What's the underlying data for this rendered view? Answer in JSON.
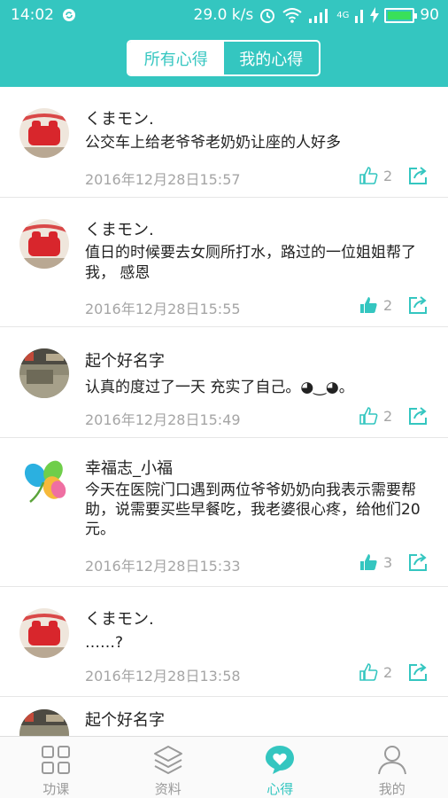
{
  "status_bar": {
    "time": "14:02",
    "speed": "29.0 k/s",
    "network": "4G",
    "battery": "90"
  },
  "segment": {
    "tabs": [
      {
        "label": "所有心得",
        "active": true
      },
      {
        "label": "我的心得",
        "active": false
      }
    ]
  },
  "posts": [
    {
      "author": "くまモン.",
      "text": "公交车上给老爷爷老奶奶让座的人好多",
      "time": "2016年12月28日15:57",
      "likes": "2",
      "liked": false,
      "avatar": "red-figure"
    },
    {
      "author": "くまモン.",
      "text": "值日的时候要去女厕所打水，路过的一位姐姐帮了我， 感恩",
      "time": "2016年12月28日15:55",
      "likes": "2",
      "liked": true,
      "avatar": "red-figure"
    },
    {
      "author": "起个好名字",
      "text": "认真的度过了一天 充实了自己。◕‿◕。",
      "time": "2016年12月28日15:49",
      "likes": "2",
      "liked": false,
      "avatar": "photo-room"
    },
    {
      "author": "幸福志_小福",
      "text": "今天在医院门口遇到两位爷爷奶奶向我表示需要帮助，说需要买些早餐吃，我老婆很心疼，给他们20元。",
      "time": "2016年12月28日15:33",
      "likes": "3",
      "liked": true,
      "avatar": "clover"
    },
    {
      "author": "くまモン.",
      "text": "……?",
      "time": "2016年12月28日13:58",
      "likes": "2",
      "liked": false,
      "avatar": "red-figure"
    },
    {
      "author": "起个好名字",
      "text": "",
      "time": "",
      "likes": "",
      "liked": false,
      "avatar": "photo-room"
    }
  ],
  "tabbar": {
    "items": [
      {
        "label": "功课",
        "icon": "grid-icon",
        "active": false
      },
      {
        "label": "资料",
        "icon": "layers-icon",
        "active": false
      },
      {
        "label": "心得",
        "icon": "heart-bubble-icon",
        "active": true
      },
      {
        "label": "我的",
        "icon": "person-icon",
        "active": false
      }
    ]
  },
  "colors": {
    "primary": "#34c6c0",
    "text": "#222222",
    "muted": "#a5a5a5"
  }
}
